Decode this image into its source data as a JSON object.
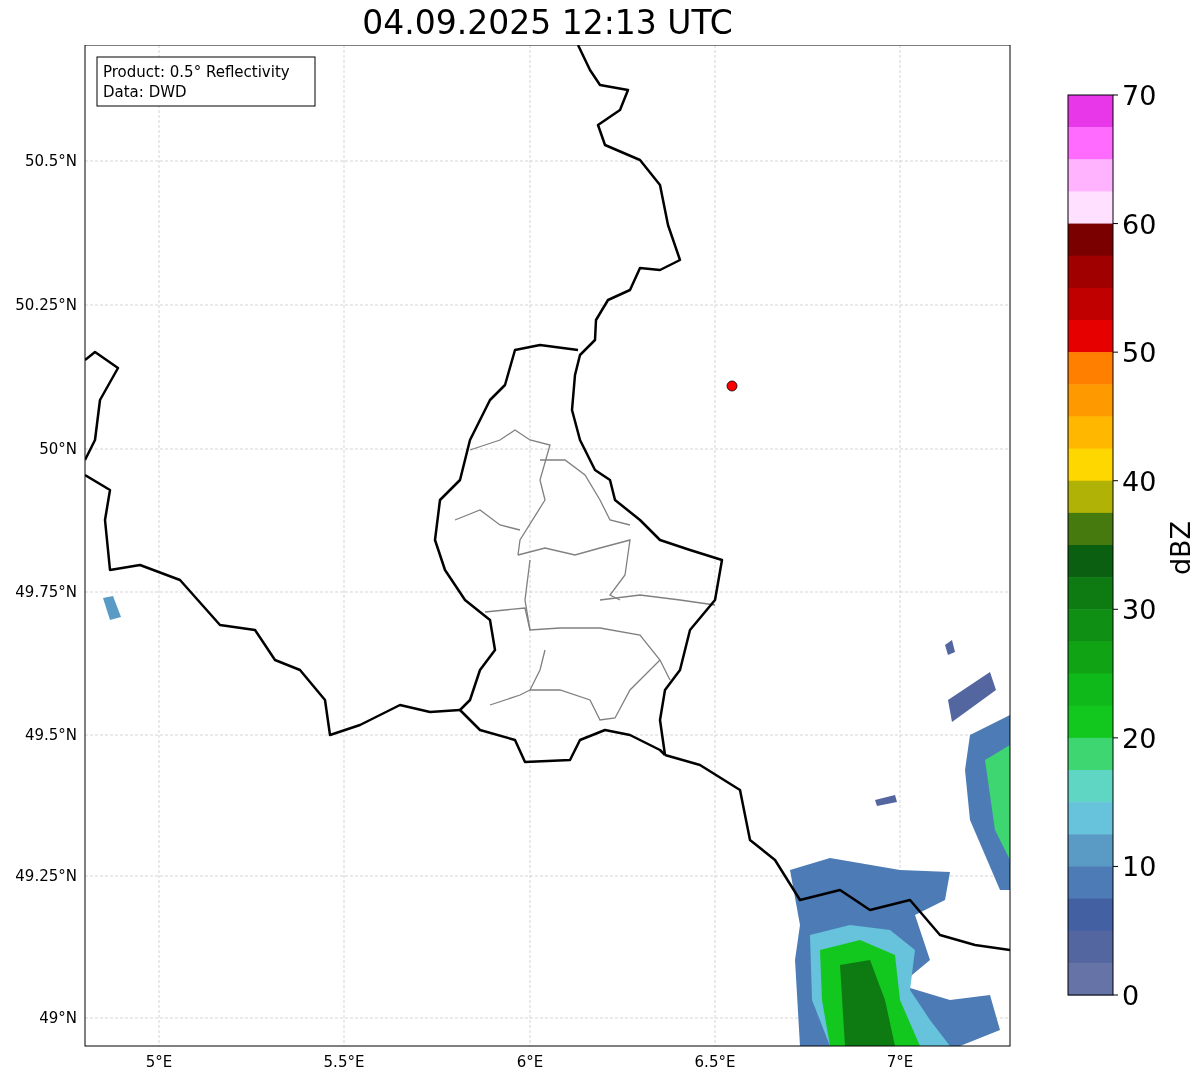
{
  "title": "04.09.2025 12:13 UTC",
  "info_box": [
    "Product: 0.5° Reflectivity",
    "Data: DWD"
  ],
  "y_ticks": [
    "50.5°N",
    "50.25°N",
    "50°N",
    "49.75°N",
    "49.5°N",
    "49.25°N",
    "49°N"
  ],
  "x_ticks": [
    "5°E",
    "5.5°E",
    "6°E",
    "6.5°E",
    "7°E"
  ],
  "colorbar": {
    "label": "dBZ",
    "ticks": [
      "70",
      "60",
      "50",
      "40",
      "30",
      "20",
      "10",
      "0"
    ],
    "segments": [
      {
        "color": "#e837e8"
      },
      {
        "color": "#ff6bff"
      },
      {
        "color": "#ffb3ff"
      },
      {
        "color": "#ffe0ff"
      },
      {
        "color": "#7a0000"
      },
      {
        "color": "#a00000"
      },
      {
        "color": "#c00000"
      },
      {
        "color": "#e60000"
      },
      {
        "color": "#ff7f00"
      },
      {
        "color": "#ff9900"
      },
      {
        "color": "#ffb700"
      },
      {
        "color": "#ffd700"
      },
      {
        "color": "#b0b206"
      },
      {
        "color": "#477a0e"
      },
      {
        "color": "#0a6010"
      },
      {
        "color": "#0d7a12"
      },
      {
        "color": "#0f8f14"
      },
      {
        "color": "#10a414"
      },
      {
        "color": "#10b91a"
      },
      {
        "color": "#12c81e"
      },
      {
        "color": "#3dd670"
      },
      {
        "color": "#5fd6c4"
      },
      {
        "color": "#67c2dc"
      },
      {
        "color": "#5a9bc6"
      },
      {
        "color": "#4d7bb6"
      },
      {
        "color": "#4360a3"
      },
      {
        "color": "#5466a0"
      },
      {
        "color": "#6673a6"
      }
    ]
  }
}
